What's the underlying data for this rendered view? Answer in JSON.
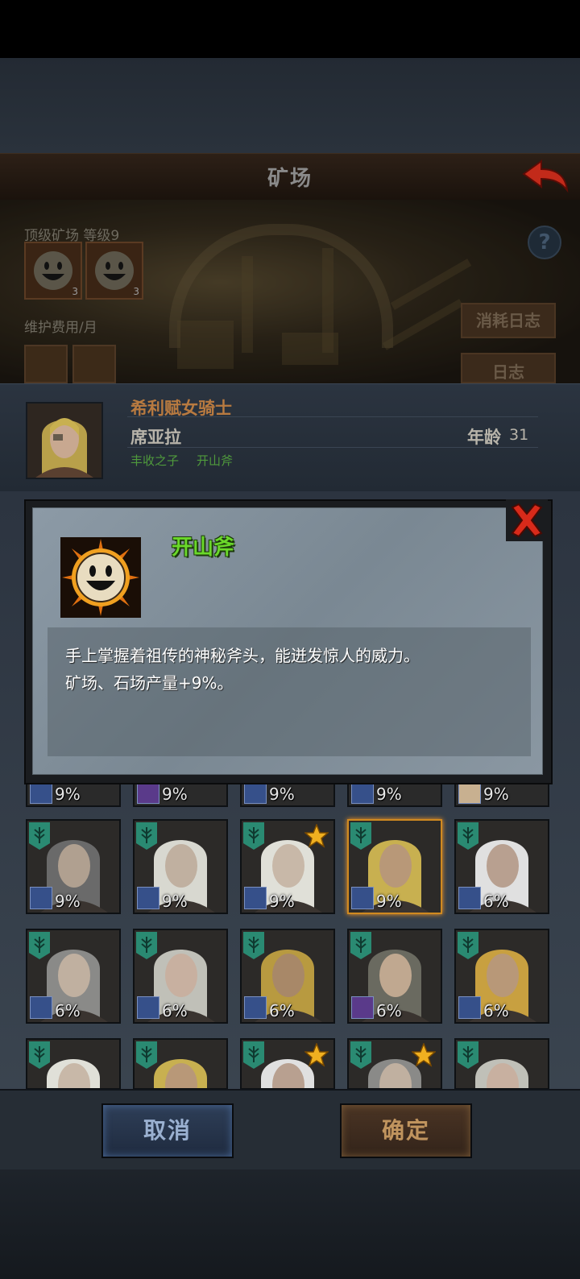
{
  "header": {
    "title": "矿场"
  },
  "mine": {
    "level_label": "顶级矿场 等级9",
    "badge_counts": [
      "3",
      "3"
    ],
    "upkeep_label": "维护费用/月",
    "help": "?",
    "consume_log_button": "消耗日志",
    "log_button": "日志"
  },
  "hero": {
    "class": "希利赋女骑士",
    "name": "席亚拉",
    "age_label": "年龄",
    "age": "31",
    "traits": [
      "丰收之子",
      "开山斧"
    ]
  },
  "dialog": {
    "skill_name": "开山斧",
    "description_line1": "手上掌握着祖传的神秘斧头，能迸发惊人的威力。",
    "description_line2": "矿场、石场产量+9%。"
  },
  "roster": {
    "partial_row": [
      "9%",
      "9%",
      "9%",
      "9%",
      "9%"
    ],
    "row1": [
      "9%",
      "9%",
      "9%",
      "9%",
      "6%"
    ],
    "row2": [
      "6%",
      "6%",
      "6%",
      "6%",
      "6%"
    ]
  },
  "footer": {
    "cancel": "取消",
    "confirm": "确定"
  },
  "colors": {
    "skill_name": "#6ad82a",
    "hero_class": "#b87a40",
    "trait": "#4f9a3c",
    "selected_tile": "#d08a20"
  }
}
